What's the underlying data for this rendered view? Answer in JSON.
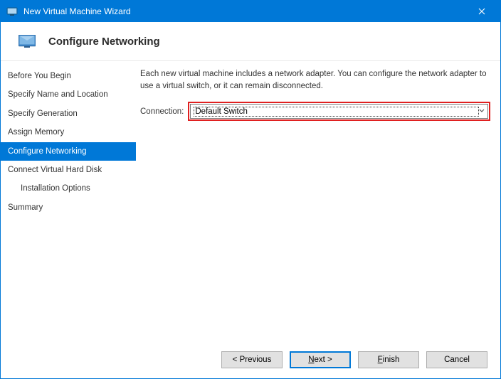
{
  "title": "New Virtual Machine Wizard",
  "page_heading": "Configure Networking",
  "sidebar": {
    "items": [
      {
        "label": "Before You Begin",
        "selected": false,
        "sub": false
      },
      {
        "label": "Specify Name and Location",
        "selected": false,
        "sub": false
      },
      {
        "label": "Specify Generation",
        "selected": false,
        "sub": false
      },
      {
        "label": "Assign Memory",
        "selected": false,
        "sub": false
      },
      {
        "label": "Configure Networking",
        "selected": true,
        "sub": false
      },
      {
        "label": "Connect Virtual Hard Disk",
        "selected": false,
        "sub": false
      },
      {
        "label": "Installation Options",
        "selected": false,
        "sub": true
      },
      {
        "label": "Summary",
        "selected": false,
        "sub": false
      }
    ]
  },
  "main": {
    "description": "Each new virtual machine includes a network adapter. You can configure the network adapter to use a virtual switch, or it can remain disconnected.",
    "connection_label": "Connection:",
    "connection_value": "Default Switch"
  },
  "footer": {
    "previous": "< Previous",
    "next_prefix": "N",
    "next_rest": "ext >",
    "finish_prefix": "F",
    "finish_rest": "inish",
    "cancel": "Cancel"
  }
}
